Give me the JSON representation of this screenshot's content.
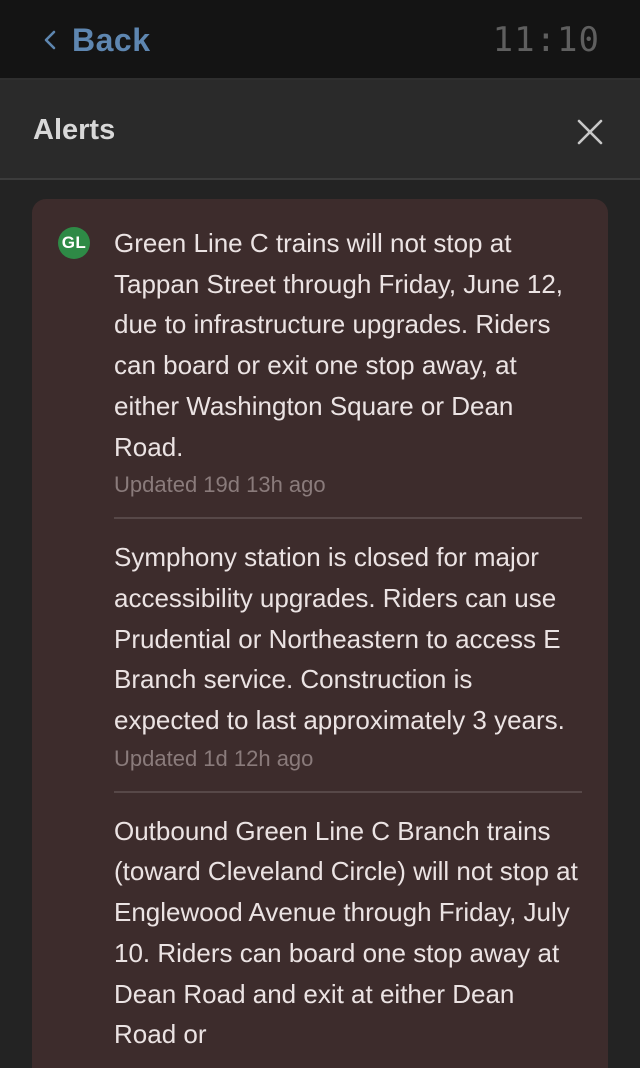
{
  "topbar": {
    "back_label": "Back",
    "clock": "11:10"
  },
  "header": {
    "title": "Alerts"
  },
  "card": {
    "badge": "GL",
    "badge_color": "#2e8a46",
    "background_color": "#3d2c2c",
    "alerts": [
      {
        "text": "Green Line C trains will not stop at Tappan Street through Friday, June 12, due to infrastructure upgrades. Riders can board or exit one stop away, at either Washington Square or Dean Road.",
        "updated": "Updated 19d 13h ago"
      },
      {
        "text": "Symphony station is closed for major accessibility upgrades. Riders can use Prudential or Northeastern to access E Branch service. Construction is expected to last approximately 3 years.",
        "updated": "Updated 1d 12h ago"
      },
      {
        "text": "Outbound Green Line C Branch trains (toward Cleveland Circle) will not stop at Englewood Avenue through Friday, July 10. Riders can board one stop away at Dean Road and exit at either Dean Road or",
        "updated": ""
      }
    ]
  },
  "icons": {
    "back": "chevron-left-icon",
    "close": "close-icon"
  },
  "colors": {
    "accent": "#5e86b0",
    "topbar_bg": "#141414",
    "header_bg": "#2a2a2a"
  }
}
